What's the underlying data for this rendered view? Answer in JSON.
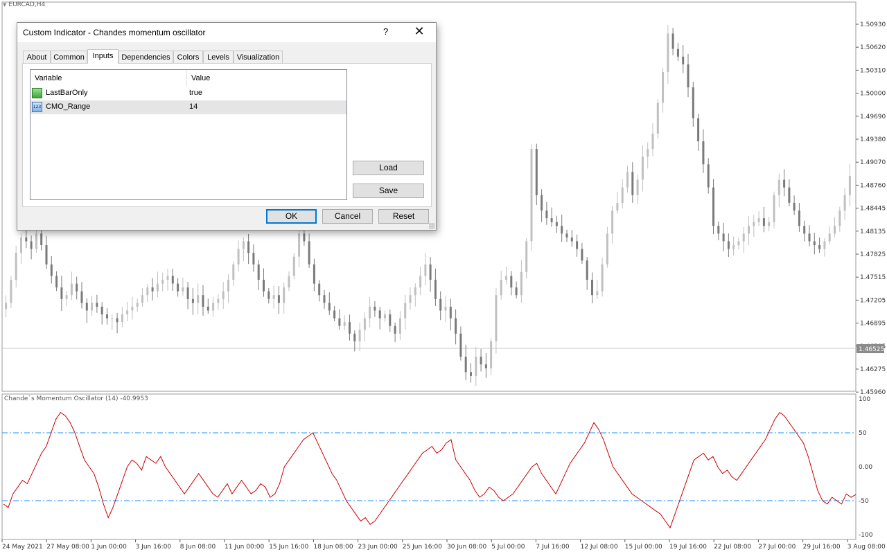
{
  "symbol": "EURCAD,H4",
  "price_axis": {
    "labels": [
      "1.50930",
      "1.50620",
      "1.50310",
      "1.50000",
      "1.49690",
      "1.49380",
      "1.49070",
      "1.48760",
      "1.48445",
      "1.48135",
      "1.47825",
      "1.47515",
      "1.47205",
      "1.46895",
      "1.46585",
      "1.46275",
      "1.45960"
    ],
    "current_price": "1.46525"
  },
  "time_axis": {
    "labels": [
      "24 May 2021",
      "27 May 08:00",
      "1 Jun 00:00",
      "3 Jun 16:00",
      "8 Jun 08:00",
      "11 Jun 00:00",
      "15 Jun 16:00",
      "18 Jun 08:00",
      "23 Jun 00:00",
      "25 Jun 16:00",
      "30 Jun 08:00",
      "5 Jul 00:00",
      "7 Jul 16:00",
      "12 Jul 08:00",
      "15 Jul 00:00",
      "19 Jul 16:00",
      "22 Jul 08:00",
      "27 Jul 00:00",
      "29 Jul 16:00",
      "3 Aug 08:00"
    ]
  },
  "indicator": {
    "label": "Chande`s Momentum Oscillator (14) -40.9953",
    "axis_labels": [
      "100",
      "50",
      "0.00",
      "-50",
      "-100"
    ],
    "line_color": "#cc0000",
    "level_color": "#1e90ff"
  },
  "dialog": {
    "title": "Custom Indicator - Chandes momentum oscillator",
    "help": "?",
    "close": "✕",
    "tabs": [
      "About",
      "Common",
      "Inputs",
      "Dependencies",
      "Colors",
      "Levels",
      "Visualization"
    ],
    "active_tab": "Inputs",
    "table": {
      "headers": {
        "variable": "Variable",
        "value": "Value"
      },
      "rows": [
        {
          "name": "LastBarOnly",
          "value": "true",
          "icon": "bool-icon"
        },
        {
          "name": "CMO_Range",
          "value": "14",
          "icon": "int-icon",
          "icon_text": "123"
        }
      ]
    },
    "buttons": {
      "load": "Load",
      "save": "Save",
      "ok": "OK",
      "cancel": "Cancel",
      "reset": "Reset"
    }
  },
  "chart_data": [
    {
      "type": "candlestick",
      "title": "EURCAD,H4",
      "ylim": [
        1.4596,
        1.51
      ],
      "close_path_main": [
        1.471,
        1.474,
        1.4775,
        1.4795,
        1.479,
        1.478,
        1.48,
        1.4785,
        1.476,
        1.4745,
        1.473,
        1.4715,
        1.472,
        1.4735,
        1.4725,
        1.471,
        1.47,
        1.471,
        1.4705,
        1.4695,
        1.469,
        1.469,
        1.4685,
        1.4695,
        1.47,
        1.4705,
        1.471,
        1.472,
        1.473,
        1.4725,
        1.4735,
        1.474,
        1.4745,
        1.4735,
        1.4725,
        1.473,
        1.4715,
        1.471,
        1.472,
        1.4705,
        1.47,
        1.471,
        1.4715,
        1.4725,
        1.474,
        1.476,
        1.478,
        1.479,
        1.4775,
        1.476,
        1.474,
        1.4725,
        1.4715,
        1.472,
        1.471,
        1.473,
        1.4745,
        1.477,
        1.48,
        1.479,
        1.476,
        1.4735,
        1.472,
        1.471,
        1.47,
        1.469,
        1.468,
        1.4685,
        1.467,
        1.466,
        1.4675,
        1.469,
        1.4705,
        1.47,
        1.469,
        1.4695,
        1.468,
        1.467,
        1.469,
        1.471,
        1.472,
        1.473,
        1.4745,
        1.476,
        1.474,
        1.4715,
        1.47,
        1.4705,
        1.469,
        1.467,
        1.464,
        1.462,
        1.4615,
        1.464,
        1.463,
        1.4625,
        1.466,
        1.472,
        1.474,
        1.4745,
        1.473,
        1.472,
        1.475,
        1.479,
        1.491,
        1.485,
        1.483,
        1.482,
        1.4815,
        1.481,
        1.48,
        1.4795,
        1.479,
        1.478,
        1.4765,
        1.474,
        1.472,
        1.4725,
        1.476,
        1.48,
        1.483,
        1.484,
        1.486,
        1.488,
        1.485,
        1.487,
        1.49,
        1.491,
        1.493,
        1.497,
        1.501,
        1.506,
        1.504,
        1.503,
        1.502,
        1.499,
        1.495,
        1.492,
        1.489,
        1.486,
        1.481,
        1.48,
        1.479,
        1.478,
        1.4785,
        1.479,
        1.48,
        1.481,
        1.4815,
        1.482,
        1.481,
        1.4815,
        1.485,
        1.487,
        1.486,
        1.484,
        1.483,
        1.481,
        1.48,
        1.479,
        1.4785,
        1.478,
        1.479,
        1.48,
        1.481,
        1.483,
        1.485,
        1.4875
      ],
      "current_price_line": 1.46525
    },
    {
      "type": "line",
      "title": "Chande`s Momentum Oscillator (14) -40.9953",
      "ylim": [
        -100,
        100
      ],
      "levels": [
        50,
        -50
      ],
      "series": [
        {
          "name": "Chande`s Momentum Oscillator (14)",
          "values": [
            -55,
            -60,
            -40,
            -30,
            -20,
            -25,
            -10,
            5,
            20,
            30,
            50,
            70,
            80,
            75,
            65,
            50,
            30,
            10,
            0,
            -10,
            -30,
            -55,
            -75,
            -60,
            -40,
            -20,
            0,
            10,
            5,
            -5,
            15,
            10,
            5,
            15,
            0,
            -10,
            -20,
            -30,
            -40,
            -30,
            -20,
            -10,
            -20,
            -30,
            -40,
            -45,
            -35,
            -25,
            -40,
            -30,
            -20,
            -30,
            -40,
            -35,
            -25,
            -30,
            -45,
            -40,
            -25,
            0,
            10,
            20,
            30,
            40,
            45,
            50,
            35,
            20,
            5,
            -10,
            -20,
            -35,
            -50,
            -60,
            -70,
            -80,
            -75,
            -85,
            -80,
            -70,
            -60,
            -50,
            -40,
            -30,
            -20,
            -10,
            0,
            10,
            20,
            25,
            30,
            20,
            25,
            35,
            40,
            10,
            0,
            -10,
            -20,
            -35,
            -45,
            -40,
            -30,
            -35,
            -45,
            -50,
            -45,
            -40,
            -30,
            -20,
            -10,
            0,
            5,
            -10,
            -20,
            -30,
            -40,
            -25,
            -10,
            5,
            15,
            25,
            35,
            50,
            65,
            55,
            40,
            20,
            0,
            -10,
            -20,
            -30,
            -40,
            -45,
            -50,
            -55,
            -60,
            -65,
            -70,
            -80,
            -90,
            -70,
            -50,
            -30,
            -10,
            10,
            15,
            20,
            10,
            15,
            0,
            -10,
            -5,
            -15,
            -20,
            -10,
            0,
            10,
            20,
            30,
            40,
            55,
            70,
            80,
            75,
            65,
            55,
            45,
            35,
            15,
            -10,
            -35,
            -50,
            -55,
            -45,
            -50,
            -55,
            -40,
            -45,
            -41
          ]
        }
      ]
    }
  ]
}
